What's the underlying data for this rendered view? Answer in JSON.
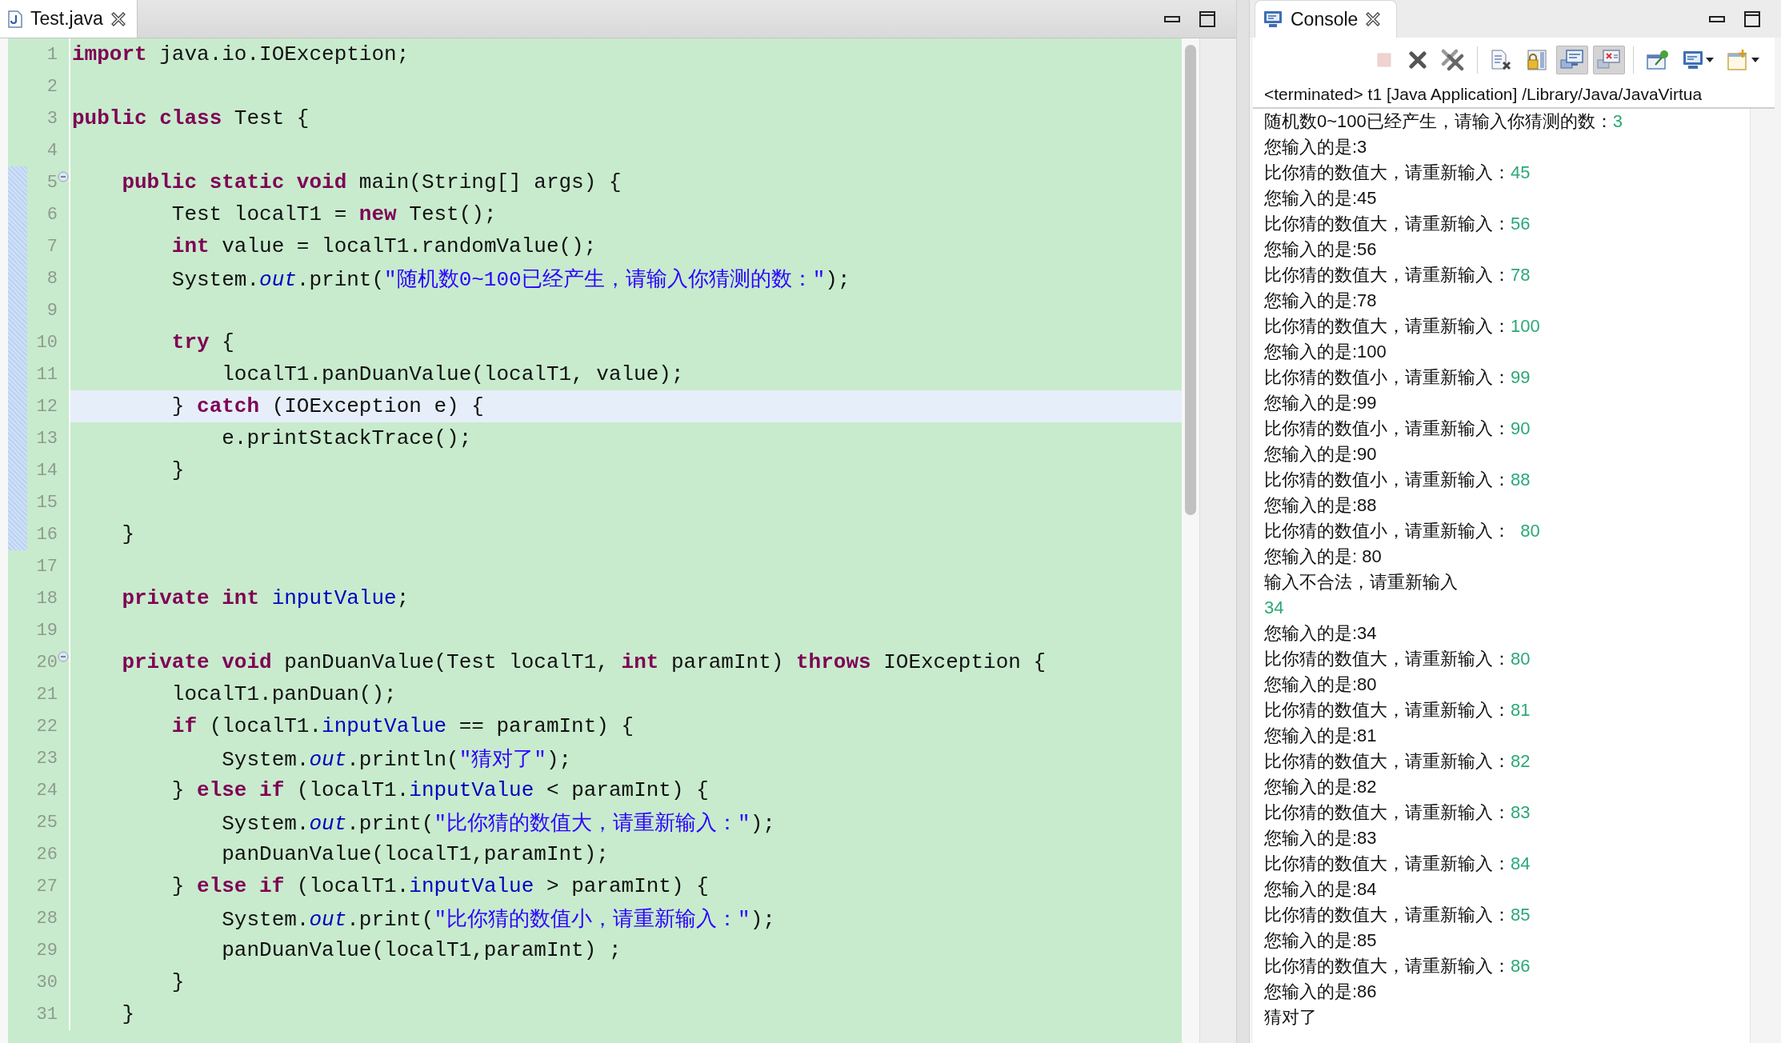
{
  "editor": {
    "tab": {
      "label": "Test.java",
      "selected": true
    },
    "lines": [
      {
        "number": "1",
        "changed": false,
        "collapsible": false,
        "current": false,
        "tokens": [
          {
            "kind": "keyword",
            "text": "import"
          },
          {
            "kind": "plain",
            "text": " java.io.IOException;"
          }
        ]
      },
      {
        "number": "2",
        "changed": false,
        "collapsible": false,
        "current": false
      },
      {
        "number": "3",
        "changed": false,
        "collapsible": false,
        "current": false,
        "tokens": [
          {
            "kind": "keyword",
            "text": "public "
          },
          {
            "kind": "keyword",
            "text": "class"
          },
          {
            "kind": "plain",
            "text": " Test {"
          }
        ]
      },
      {
        "number": "4",
        "changed": false,
        "collapsible": false,
        "current": false
      },
      {
        "number": "5",
        "changed": true,
        "collapsible": true,
        "current": false,
        "tokens": [
          {
            "kind": "keyword",
            "text": "    public "
          },
          {
            "kind": "keyword",
            "text": "static "
          },
          {
            "kind": "keyword",
            "text": "void"
          },
          {
            "kind": "plain",
            "text": " main(String[] args) {"
          }
        ]
      },
      {
        "number": "6",
        "changed": true,
        "collapsible": false,
        "current": false,
        "tokens": [
          {
            "kind": "plain",
            "text": "        Test localT1 = "
          },
          {
            "kind": "keyword",
            "text": "new"
          },
          {
            "kind": "plain",
            "text": " Test();"
          }
        ]
      },
      {
        "number": "7",
        "changed": true,
        "collapsible": false,
        "current": false,
        "tokens": [
          {
            "kind": "keyword",
            "text": "        int"
          },
          {
            "kind": "plain",
            "text": " value = localT1.randomValue();"
          }
        ]
      },
      {
        "number": "8",
        "changed": true,
        "collapsible": false,
        "current": false,
        "tokens": [
          {
            "kind": "plain",
            "text": "        System."
          },
          {
            "kind": "field",
            "text": "out"
          },
          {
            "kind": "plain",
            "text": ".print("
          },
          {
            "kind": "string",
            "text": "\"随机数0~100已经产生，请输入你猜测的数：\""
          },
          {
            "kind": "plain",
            "text": ");"
          }
        ]
      },
      {
        "number": "9",
        "changed": true,
        "collapsible": false,
        "current": false
      },
      {
        "number": "10",
        "changed": true,
        "collapsible": false,
        "current": false,
        "tokens": [
          {
            "kind": "keyword",
            "text": "        try"
          },
          {
            "kind": "plain",
            "text": " {"
          }
        ]
      },
      {
        "number": "11",
        "changed": true,
        "collapsible": false,
        "current": false,
        "tokens": [
          {
            "kind": "plain",
            "text": "            localT1.panDuanValue(localT1, value);"
          }
        ]
      },
      {
        "number": "12",
        "changed": true,
        "collapsible": false,
        "current": true,
        "tokens": [
          {
            "kind": "plain",
            "text": "        } "
          },
          {
            "kind": "keyword",
            "text": "catch"
          },
          {
            "kind": "plain",
            "text": " (IOException e) {"
          }
        ]
      },
      {
        "number": "13",
        "changed": true,
        "collapsible": false,
        "current": false,
        "tokens": [
          {
            "kind": "plain",
            "text": "            e.printStackTrace();"
          }
        ]
      },
      {
        "number": "14",
        "changed": true,
        "collapsible": false,
        "current": false,
        "tokens": [
          {
            "kind": "plain",
            "text": "        }"
          }
        ]
      },
      {
        "number": "15",
        "changed": true,
        "collapsible": false,
        "current": false
      },
      {
        "number": "16",
        "changed": true,
        "collapsible": false,
        "current": false,
        "tokens": [
          {
            "kind": "plain",
            "text": "    }"
          }
        ]
      },
      {
        "number": "17",
        "changed": false,
        "collapsible": false,
        "current": false
      },
      {
        "number": "18",
        "changed": false,
        "collapsible": false,
        "current": false,
        "tokens": [
          {
            "kind": "keyword",
            "text": "    private "
          },
          {
            "kind": "keyword",
            "text": "int "
          },
          {
            "kind": "member",
            "text": "inputValue"
          },
          {
            "kind": "plain",
            "text": ";"
          }
        ]
      },
      {
        "number": "19",
        "changed": false,
        "collapsible": false,
        "current": false
      },
      {
        "number": "20",
        "changed": false,
        "collapsible": true,
        "current": false,
        "tokens": [
          {
            "kind": "keyword",
            "text": "    private "
          },
          {
            "kind": "keyword",
            "text": "void"
          },
          {
            "kind": "plain",
            "text": " panDuanValue(Test localT1, "
          },
          {
            "kind": "keyword",
            "text": "int"
          },
          {
            "kind": "plain",
            "text": " paramInt) "
          },
          {
            "kind": "keyword",
            "text": "throws"
          },
          {
            "kind": "plain",
            "text": " IOException {"
          }
        ]
      },
      {
        "number": "21",
        "changed": false,
        "collapsible": false,
        "current": false,
        "tokens": [
          {
            "kind": "plain",
            "text": "        localT1.panDuan();"
          }
        ]
      },
      {
        "number": "22",
        "changed": false,
        "collapsible": false,
        "current": false,
        "tokens": [
          {
            "kind": "keyword",
            "text": "        if"
          },
          {
            "kind": "plain",
            "text": " (localT1."
          },
          {
            "kind": "member",
            "text": "inputValue"
          },
          {
            "kind": "plain",
            "text": " == paramInt) {"
          }
        ]
      },
      {
        "number": "23",
        "changed": false,
        "collapsible": false,
        "current": false,
        "tokens": [
          {
            "kind": "plain",
            "text": "            System."
          },
          {
            "kind": "field",
            "text": "out"
          },
          {
            "kind": "plain",
            "text": ".println("
          },
          {
            "kind": "string",
            "text": "\"猜对了\""
          },
          {
            "kind": "plain",
            "text": ");"
          }
        ]
      },
      {
        "number": "24",
        "changed": false,
        "collapsible": false,
        "current": false,
        "tokens": [
          {
            "kind": "plain",
            "text": "        } "
          },
          {
            "kind": "keyword",
            "text": "else "
          },
          {
            "kind": "keyword",
            "text": "if"
          },
          {
            "kind": "plain",
            "text": " (localT1."
          },
          {
            "kind": "member",
            "text": "inputValue"
          },
          {
            "kind": "plain",
            "text": " < paramInt) {"
          }
        ]
      },
      {
        "number": "25",
        "changed": false,
        "collapsible": false,
        "current": false,
        "tokens": [
          {
            "kind": "plain",
            "text": "            System."
          },
          {
            "kind": "field",
            "text": "out"
          },
          {
            "kind": "plain",
            "text": ".print("
          },
          {
            "kind": "string",
            "text": "\"比你猜的数值大，请重新输入：\""
          },
          {
            "kind": "plain",
            "text": ");"
          }
        ]
      },
      {
        "number": "26",
        "changed": false,
        "collapsible": false,
        "current": false,
        "tokens": [
          {
            "kind": "plain",
            "text": "            panDuanValue(localT1,paramInt);"
          }
        ]
      },
      {
        "number": "27",
        "changed": false,
        "collapsible": false,
        "current": false,
        "tokens": [
          {
            "kind": "plain",
            "text": "        } "
          },
          {
            "kind": "keyword",
            "text": "else "
          },
          {
            "kind": "keyword",
            "text": "if"
          },
          {
            "kind": "plain",
            "text": " (localT1."
          },
          {
            "kind": "member",
            "text": "inputValue"
          },
          {
            "kind": "plain",
            "text": " > paramInt) {"
          }
        ]
      },
      {
        "number": "28",
        "changed": false,
        "collapsible": false,
        "current": false,
        "tokens": [
          {
            "kind": "plain",
            "text": "            System."
          },
          {
            "kind": "field",
            "text": "out"
          },
          {
            "kind": "plain",
            "text": ".print("
          },
          {
            "kind": "string",
            "text": "\"比你猜的数值小，请重新输入：\""
          },
          {
            "kind": "plain",
            "text": ");"
          }
        ]
      },
      {
        "number": "29",
        "changed": false,
        "collapsible": false,
        "current": false,
        "tokens": [
          {
            "kind": "plain",
            "text": "            panDuanValue(localT1,paramInt) ;"
          }
        ]
      },
      {
        "number": "30",
        "changed": false,
        "collapsible": false,
        "current": false,
        "tokens": [
          {
            "kind": "plain",
            "text": "        }"
          }
        ]
      },
      {
        "number": "31",
        "changed": false,
        "collapsible": false,
        "current": false,
        "tokens": [
          {
            "kind": "plain",
            "text": "    }"
          }
        ]
      }
    ]
  },
  "console": {
    "tab": {
      "label": "Console",
      "selected": true
    },
    "toolbar": [
      {
        "kind": "stop",
        "pressed": false,
        "disabled": true,
        "dropdown": false
      },
      {
        "kind": "remove",
        "pressed": false,
        "disabled": false,
        "dropdown": false
      },
      {
        "kind": "remove-all",
        "pressed": false,
        "disabled": false,
        "dropdown": false
      },
      {
        "kind": "clear",
        "pressed": false,
        "disabled": false,
        "dropdown": false
      },
      {
        "kind": "scroll-lock",
        "pressed": false,
        "disabled": false,
        "dropdown": false
      },
      {
        "kind": "show-on-output",
        "pressed": true,
        "disabled": false,
        "dropdown": false
      },
      {
        "kind": "show-on-error",
        "pressed": true,
        "disabled": false,
        "dropdown": false
      },
      {
        "kind": "pin",
        "pressed": false,
        "disabled": false,
        "dropdown": false
      },
      {
        "kind": "display-console",
        "pressed": false,
        "disabled": false,
        "dropdown": true
      },
      {
        "kind": "new-console",
        "pressed": false,
        "disabled": false,
        "dropdown": true
      }
    ],
    "status": "<terminated> t1 [Java Application] /Library/Java/JavaVirtua",
    "lines": [
      {
        "output": "随机数0~100已经产生，请输入你猜测的数：",
        "input": "3"
      },
      {
        "output": "您输入的是:3"
      },
      {
        "output": "比你猜的数值大，请重新输入：",
        "input": "45"
      },
      {
        "output": "您输入的是:45"
      },
      {
        "output": "比你猜的数值大，请重新输入：",
        "input": "56"
      },
      {
        "output": "您输入的是:56"
      },
      {
        "output": "比你猜的数值大，请重新输入：",
        "input": "78"
      },
      {
        "output": "您输入的是:78"
      },
      {
        "output": "比你猜的数值大，请重新输入：",
        "input": "100"
      },
      {
        "output": "您输入的是:100"
      },
      {
        "output": "比你猜的数值小，请重新输入：",
        "input": "99"
      },
      {
        "output": "您输入的是:99"
      },
      {
        "output": "比你猜的数值小，请重新输入：",
        "input": "90"
      },
      {
        "output": "您输入的是:90"
      },
      {
        "output": "比你猜的数值小，请重新输入：",
        "input": "88"
      },
      {
        "output": "您输入的是:88"
      },
      {
        "output": "比你猜的数值小，请重新输入：",
        "input": "  80"
      },
      {
        "output": "您输入的是: 80"
      },
      {
        "output": "输入不合法，请重新输入"
      },
      {
        "input": "34"
      },
      {
        "output": "您输入的是:34"
      },
      {
        "output": "比你猜的数值大，请重新输入：",
        "input": "80"
      },
      {
        "output": "您输入的是:80"
      },
      {
        "output": "比你猜的数值大，请重新输入：",
        "input": "81"
      },
      {
        "output": "您输入的是:81"
      },
      {
        "output": "比你猜的数值大，请重新输入：",
        "input": "82"
      },
      {
        "output": "您输入的是:82"
      },
      {
        "output": "比你猜的数值大，请重新输入：",
        "input": "83"
      },
      {
        "output": "您输入的是:83"
      },
      {
        "output": "比你猜的数值大，请重新输入：",
        "input": "84"
      },
      {
        "output": "您输入的是:84"
      },
      {
        "output": "比你猜的数值大，请重新输入：",
        "input": "85"
      },
      {
        "output": "您输入的是:85"
      },
      {
        "output": "比你猜的数值大，请重新输入：",
        "input": "86"
      },
      {
        "output": "您输入的是:86"
      },
      {
        "output": "猜对了"
      }
    ]
  }
}
